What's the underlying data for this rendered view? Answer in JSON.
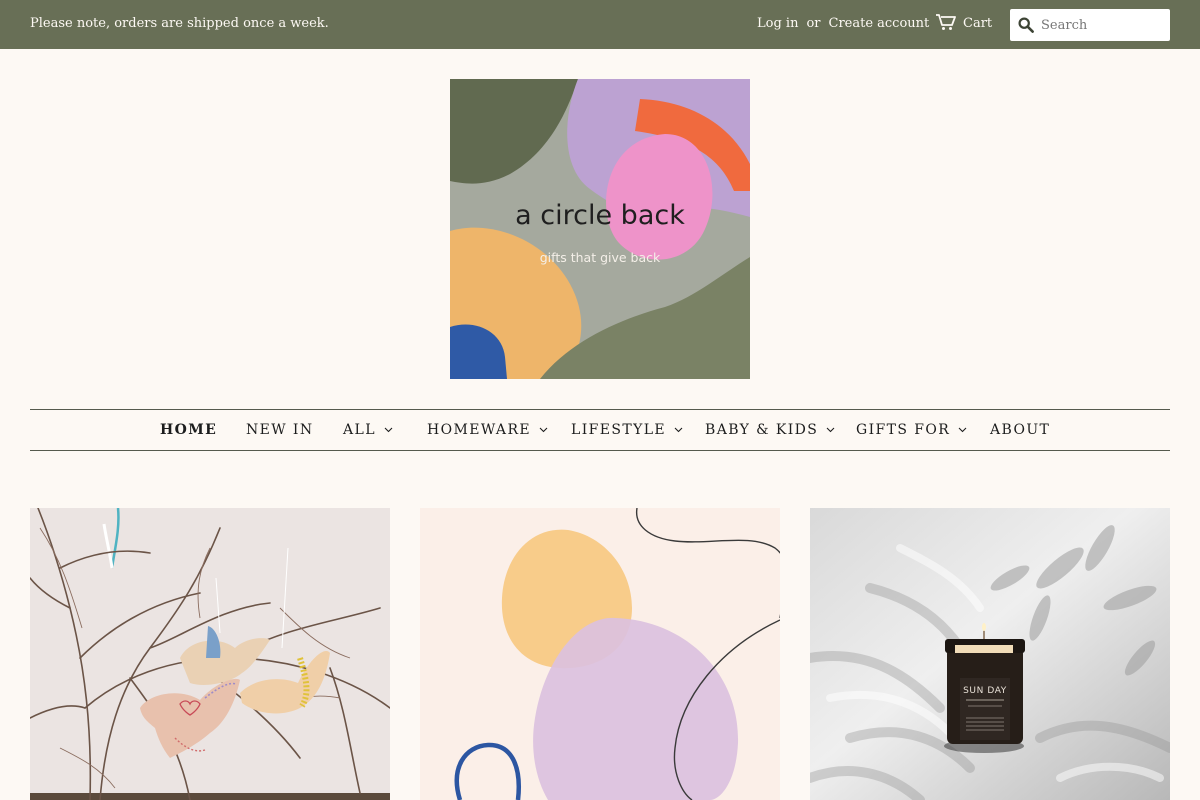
{
  "header": {
    "announcement": "Please note, orders are shipped once a week.",
    "login_label": "Log in",
    "or_label": "or",
    "create_account_label": "Create account",
    "cart_label": "Cart",
    "search_placeholder": "Search"
  },
  "logo": {
    "title": "a circle back",
    "tagline": "gifts that give back"
  },
  "nav": {
    "items": [
      {
        "label": "HOME",
        "active": true
      },
      {
        "label": "NEW IN"
      },
      {
        "label": "ALL",
        "dropdown": true
      },
      {
        "label": "HOMEWARE",
        "dropdown": true
      },
      {
        "label": "LIFESTYLE",
        "dropdown": true
      },
      {
        "label": "BABY & KIDS",
        "dropdown": true
      },
      {
        "label": "GIFTS FOR",
        "dropdown": true
      },
      {
        "label": "ABOUT"
      }
    ]
  },
  "candle": {
    "brand": "SUN DAY"
  },
  "colors": {
    "topbar": "#686f56",
    "background": "#fdf9f4"
  }
}
